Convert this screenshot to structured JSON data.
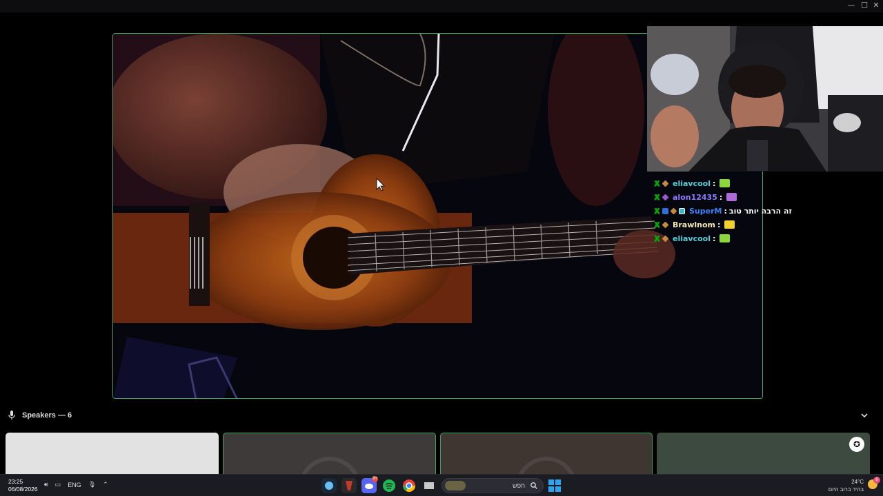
{
  "window": {
    "minimize_glyph": "—",
    "maximize_glyph": "☐",
    "close_glyph": "✕"
  },
  "chat": {
    "messages": [
      {
        "user": "eliavcool",
        "user_color": "#4fd1d9",
        "badges": [
          "mod",
          "pick"
        ],
        "sep": ":",
        "text": "",
        "emote_color": "#8ad83b"
      },
      {
        "user": "alon12435",
        "user_color": "#8a7bff",
        "badges": [
          "mod",
          "pick-purple"
        ],
        "sep": ":",
        "text": "",
        "emote_color": "#b06ad8"
      },
      {
        "user": "SuperM",
        "user_color": "#3b82f6",
        "badges": [
          "mod",
          "blue",
          "pick",
          "cyan"
        ],
        "sep": ":",
        "text": "זה הרבה יותר טוב",
        "emote_color": ""
      },
      {
        "user": "Brawlnom",
        "user_color": "#f3e7b4",
        "badges": [
          "mod",
          "pick"
        ],
        "sep": ":",
        "text": "",
        "emote_color": "#f2d22e"
      },
      {
        "user": "eliavcool",
        "user_color": "#4fd1d9",
        "badges": [
          "mod",
          "pick"
        ],
        "sep": ":",
        "text": "",
        "emote_color": "#8ad83b"
      }
    ]
  },
  "speakers": {
    "label": "Speakers — 6"
  },
  "tiles": [
    {
      "bg": "#e2e2e2",
      "active": false
    },
    {
      "bg": "#3d3a39",
      "active": true
    },
    {
      "bg": "#3f3531",
      "active": true
    },
    {
      "bg": "#3c4a3f",
      "active": false
    }
  ],
  "taskbar": {
    "time": "23:25",
    "date": "06/08/2026",
    "language": "ENG",
    "search_placeholder": "חפש",
    "weather_temp": "24°C",
    "weather_desc": "בהיר ברוב היום",
    "notification_count": "8",
    "discord_badge": "9+"
  },
  "colors": {
    "speaking_border": "#3ba55d",
    "taskbar_bg": "#1b1b22"
  }
}
